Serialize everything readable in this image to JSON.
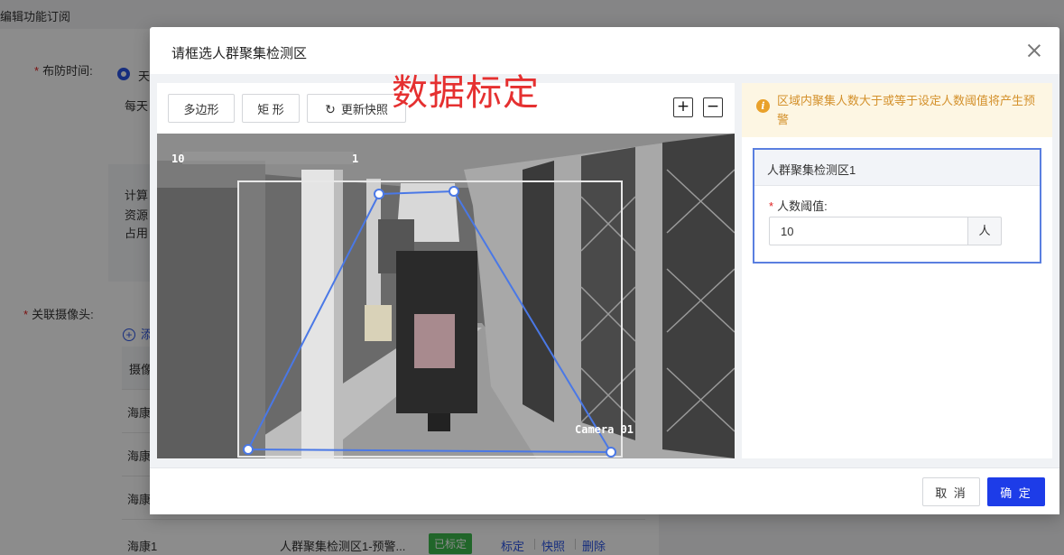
{
  "background": {
    "header": "编辑功能订阅",
    "defense_time_label": "布防时间:",
    "defense_radio_text": "天",
    "defense_sub_text": "每天",
    "info_lines": [
      "计算",
      "资源",
      "占用"
    ],
    "camera_label": "关联摄像头:",
    "add_text": "添",
    "table_header_first": "摄像",
    "rows": [
      {
        "name": "海康"
      },
      {
        "name": "海康"
      },
      {
        "name": "海康"
      },
      {
        "name": "海康1",
        "zone": "人群聚集检测区1-预警...",
        "status": "已标定",
        "actions": [
          "标定",
          "快照",
          "删除"
        ]
      }
    ]
  },
  "modal": {
    "title": "请框选人群聚集检测区",
    "annotation": "数据标定",
    "toolbar": {
      "polygon": "多边形",
      "rectangle": "矩 形",
      "refresh": "更新快照",
      "zoom_in": "+",
      "zoom_out": "−"
    },
    "camera": {
      "timestamp": "10",
      "timestamp_suffix": "1",
      "overlay_label": "Camera 01"
    },
    "alert_text": "区域内聚集人数大于或等于设定人数阈值将产生预警",
    "zone": {
      "title": "人群聚集检测区1",
      "threshold_label": "人数阈值:",
      "threshold_value": "10",
      "unit": "人"
    },
    "footer": {
      "cancel": "取 消",
      "ok": "确 定"
    }
  },
  "colors": {
    "primary": "#1d3ce8",
    "annotation": "#e53030",
    "warning_text": "#d4912c",
    "warning_bg": "#fdf6e3",
    "polygon": "#4a78e6",
    "success": "#3dba4e"
  }
}
